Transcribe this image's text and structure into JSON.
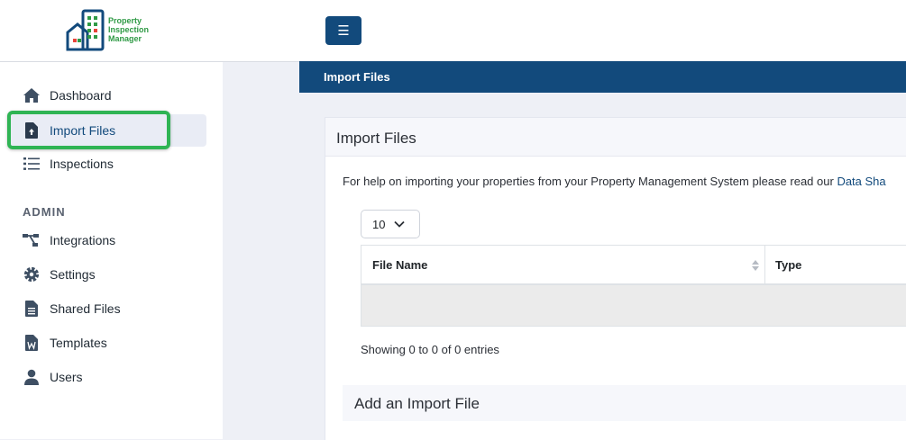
{
  "brand": {
    "line1": "Property",
    "line2": "Inspection",
    "line3": "Manager"
  },
  "header": {
    "toggle_icon": "☰"
  },
  "sidebar": {
    "items": [
      {
        "label": "Dashboard",
        "icon": "home-icon"
      },
      {
        "label": "Import Files",
        "icon": "file-upload-icon",
        "active": true
      },
      {
        "label": "Inspections",
        "icon": "list-icon"
      }
    ],
    "admin_heading": "ADMIN",
    "admin_items": [
      {
        "label": "Integrations",
        "icon": "sitemap-icon"
      },
      {
        "label": "Settings",
        "icon": "gear-icon"
      },
      {
        "label": "Shared Files",
        "icon": "document-icon"
      },
      {
        "label": "Templates",
        "icon": "word-file-icon"
      },
      {
        "label": "Users",
        "icon": "user-icon"
      }
    ]
  },
  "page": {
    "title": "Import Files"
  },
  "card": {
    "title": "Import Files",
    "help_text": "For help on importing your properties from your Property Management System please read our ",
    "help_link": "Data Sha",
    "page_length": "10",
    "table": {
      "columns": [
        "File Name",
        "Type"
      ],
      "rows": []
    },
    "info": "Showing 0 to 0 of 0 entries",
    "add_title": "Add an Import File"
  },
  "colors": {
    "brand": "#124a7c",
    "highlight": "#2fb454",
    "logo_green": "#2f9a45",
    "logo_red": "#e8443a"
  }
}
